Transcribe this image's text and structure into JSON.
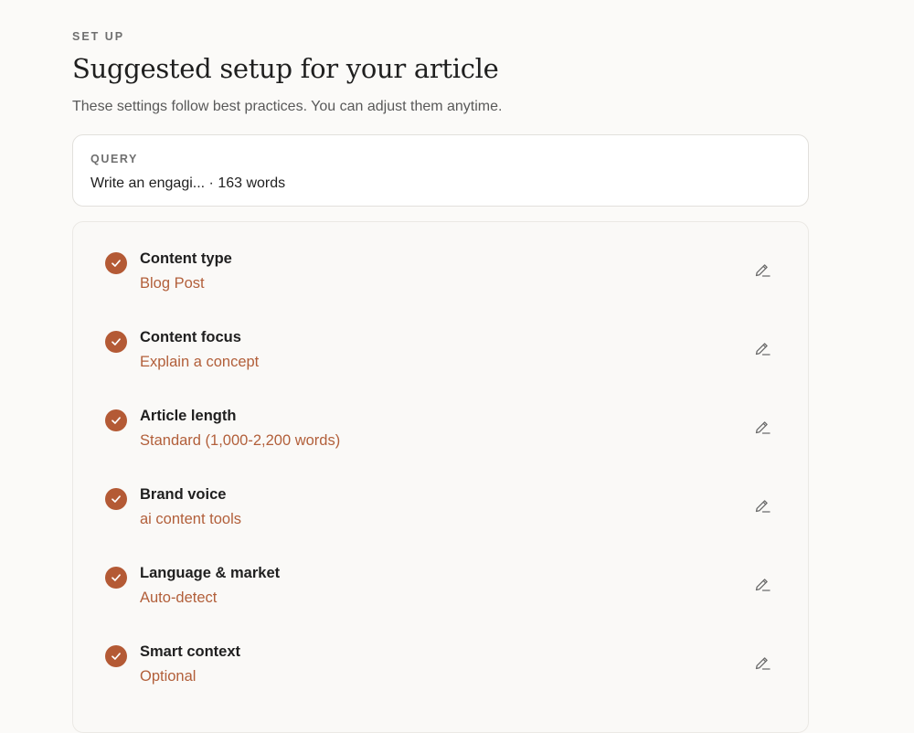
{
  "header": {
    "eyebrow": "SET UP",
    "title": "Suggested setup for your article",
    "subtitle": "These settings follow best practices. You can adjust them anytime."
  },
  "query": {
    "label": "QUERY",
    "text": "Write an engagi... · 163 words"
  },
  "settings": [
    {
      "title": "Content type",
      "value": "Blog Post"
    },
    {
      "title": "Content focus",
      "value": "Explain a concept"
    },
    {
      "title": "Article length",
      "value": "Standard (1,000-2,200 words)"
    },
    {
      "title": "Brand voice",
      "value": "ai content tools"
    },
    {
      "title": "Language & market",
      "value": "Auto-detect"
    },
    {
      "title": "Smart context",
      "value": "Optional"
    }
  ],
  "icons": {
    "check": "check-icon",
    "edit": "pencil-icon"
  },
  "colors": {
    "accent": "#b45a35",
    "value_text": "#b25f3a",
    "background": "#fbfaf8"
  }
}
